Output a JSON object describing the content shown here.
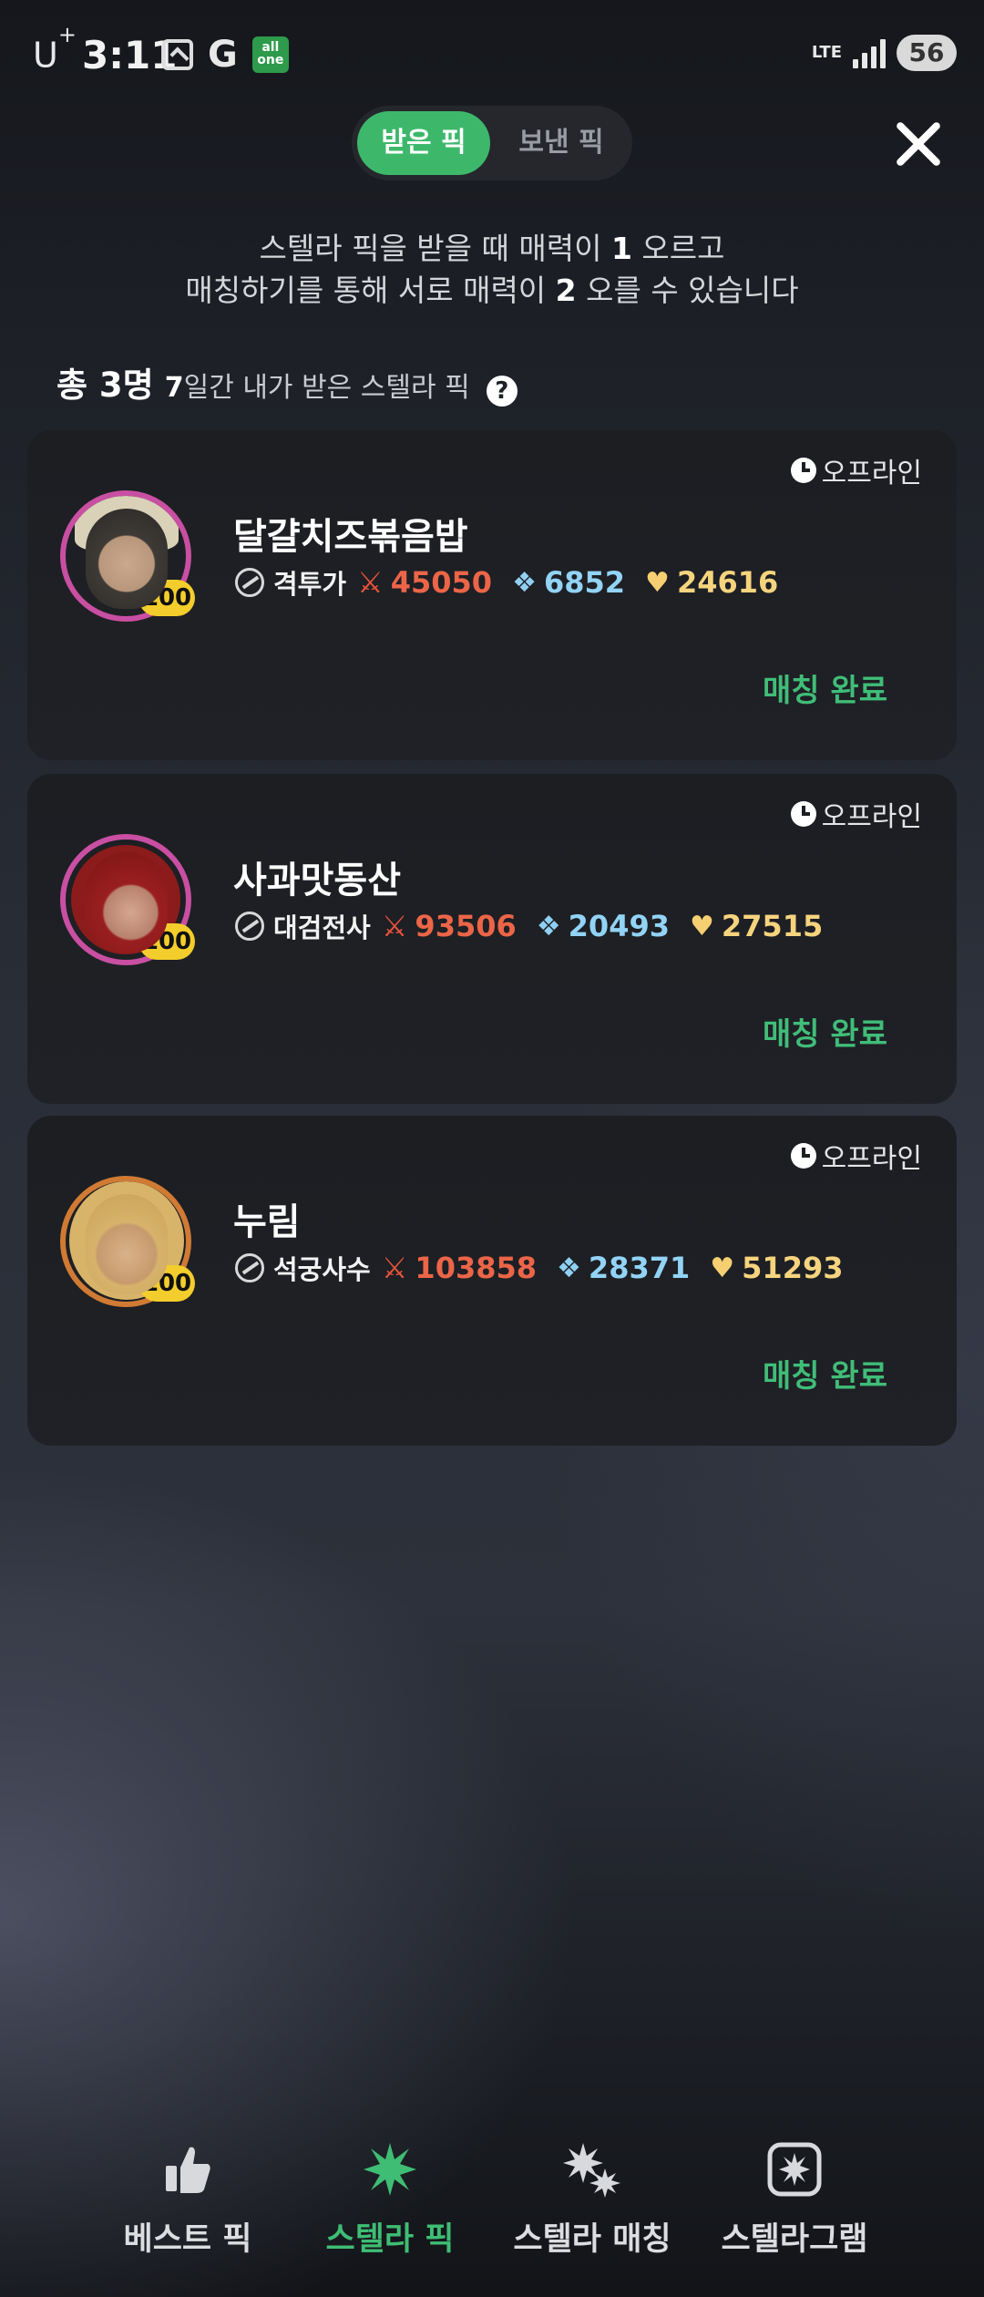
{
  "status_bar": {
    "carrier": "U",
    "carrier_plus": "+",
    "time": "3:11",
    "g_label": "G",
    "allone_label": "all one",
    "network": "LTE",
    "battery": "56"
  },
  "tabs": {
    "received": "받은 픽",
    "sent": "보낸 픽"
  },
  "info": {
    "line1_pre": "스텔라 픽을 받을 때 매력이 ",
    "line1_num": "1",
    "line1_post": " 오르고",
    "line2_pre": "매칭하기를 통해 서로 매력이 ",
    "line2_num": "2",
    "line2_post": " 오를 수 있습니다"
  },
  "summary": {
    "total": "총 3명",
    "days": "7",
    "period_text": "일간 내가 받은 스텔라 픽",
    "help": "?"
  },
  "cards": [
    {
      "status": "오프라인",
      "name": "달걀치즈볶음밥",
      "level": "100",
      "class": "격투가",
      "attack": "45050",
      "defense": "6852",
      "charm": "24616",
      "action": "매칭 완료"
    },
    {
      "status": "오프라인",
      "name": "사과맛동산",
      "level": "100",
      "class": "대검전사",
      "attack": "93506",
      "defense": "20493",
      "charm": "27515",
      "action": "매칭 완료"
    },
    {
      "status": "오프라인",
      "name": "누림",
      "level": "100",
      "class": "석궁사수",
      "attack": "103858",
      "defense": "28371",
      "charm": "51293",
      "action": "매칭 완료"
    }
  ],
  "bottom_nav": [
    {
      "label": "베스트 픽",
      "icon": "thumbs-up-icon"
    },
    {
      "label": "스텔라 픽",
      "icon": "star-burst-icon",
      "active": true
    },
    {
      "label": "스텔라 매칭",
      "icon": "sparkles-icon"
    },
    {
      "label": "스텔라그램",
      "icon": "stellagram-icon"
    }
  ],
  "colors": {
    "accent_green": "#3db86b",
    "attack": "#ec6548",
    "defense": "#92d3f6",
    "charm": "#f6d47e",
    "level_badge": "#f3cd2c"
  }
}
